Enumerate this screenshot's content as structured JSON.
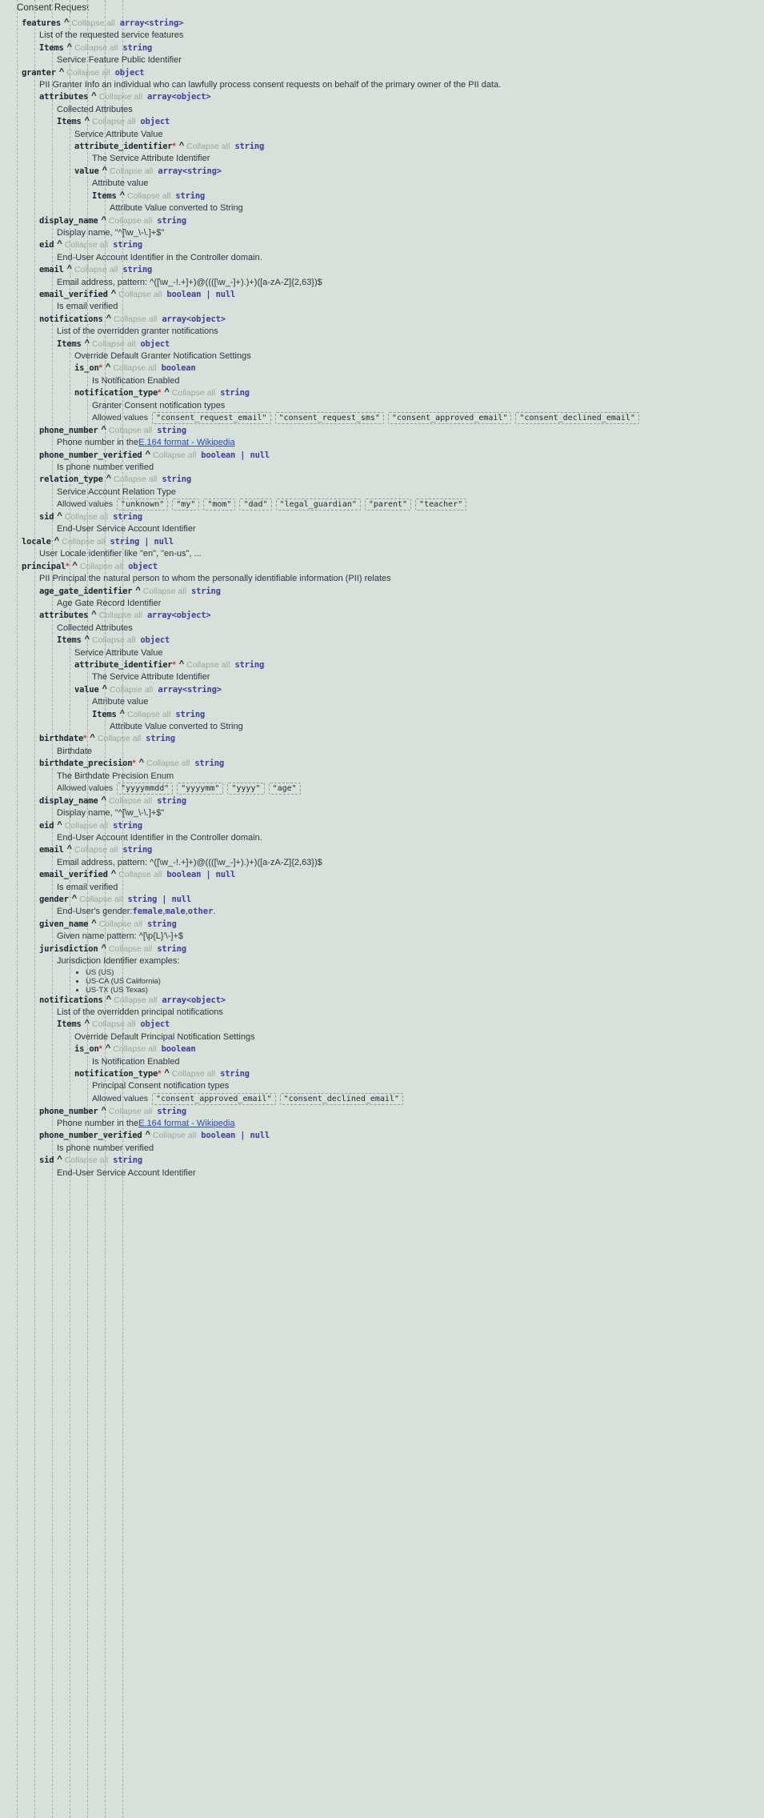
{
  "page": {
    "title": "Consent Request",
    "collapse_label": "Collapse all",
    "allowed_values_label": "Allowed values",
    "required_marker": "*",
    "caret_glyph": "^",
    "colors": {
      "background": "#d7e0d9",
      "type_text": "#3b3fa0",
      "required": "#e03131",
      "collapse": "#9aa6a0",
      "link": "#2848b8",
      "guide": "#9fb0a6"
    }
  },
  "rows": [
    {
      "depth": 0,
      "kind": "prop",
      "key": "features",
      "type": "array<string>"
    },
    {
      "depth": 1,
      "kind": "desc",
      "text": "List of the requested service features"
    },
    {
      "depth": 1,
      "kind": "prop",
      "key": "Items",
      "type": "string"
    },
    {
      "depth": 2,
      "kind": "desc",
      "text": "Service Feature Public Identifier"
    },
    {
      "depth": 0,
      "kind": "prop",
      "key": "granter",
      "type": "object"
    },
    {
      "depth": 1,
      "kind": "desc",
      "text": "PII Granter Info an individual who can lawfully process consent requests on behalf of the primary owner of the PII data."
    },
    {
      "depth": 1,
      "kind": "prop",
      "key": "attributes",
      "type": "array<object>"
    },
    {
      "depth": 2,
      "kind": "desc",
      "text": "Collected Attributes"
    },
    {
      "depth": 2,
      "kind": "prop",
      "key": "Items",
      "type": "object"
    },
    {
      "depth": 3,
      "kind": "desc",
      "text": "Service Attribute Value"
    },
    {
      "depth": 3,
      "kind": "prop",
      "key": "attribute_identifier",
      "required": true,
      "type": "string"
    },
    {
      "depth": 4,
      "kind": "desc",
      "text": "The Service Attribute Identifier"
    },
    {
      "depth": 3,
      "kind": "prop",
      "key": "value",
      "type": "array<string>"
    },
    {
      "depth": 4,
      "kind": "desc",
      "text": "Attribute value"
    },
    {
      "depth": 4,
      "kind": "prop",
      "key": "Items",
      "type": "string"
    },
    {
      "depth": 5,
      "kind": "desc",
      "text": "Attribute Value converted to String"
    },
    {
      "depth": 1,
      "kind": "prop",
      "key": "display_name",
      "type": "string"
    },
    {
      "depth": 2,
      "kind": "desc",
      "text": "Display name, \"^[\\w_\\-\\.]+$\""
    },
    {
      "depth": 1,
      "kind": "prop",
      "key": "eid",
      "type": "string"
    },
    {
      "depth": 2,
      "kind": "desc",
      "text": "End-User Account Identifier in the Controller domain."
    },
    {
      "depth": 1,
      "kind": "prop",
      "key": "email",
      "type": "string"
    },
    {
      "depth": 2,
      "kind": "desc",
      "text": "Email address, pattern: ^([\\w_-!.+]+)@((([\\w_-]+).)+)([a-zA-Z]{2,63})$"
    },
    {
      "depth": 1,
      "kind": "prop",
      "key": "email_verified",
      "type": "boolean | null"
    },
    {
      "depth": 2,
      "kind": "desc",
      "text": "Is email verified"
    },
    {
      "depth": 1,
      "kind": "prop",
      "key": "notifications",
      "type": "array<object>"
    },
    {
      "depth": 2,
      "kind": "desc",
      "text": "List of the overridden granter notifications"
    },
    {
      "depth": 2,
      "kind": "prop",
      "key": "Items",
      "type": "object"
    },
    {
      "depth": 3,
      "kind": "desc",
      "text": "Override Default Granter Notification Settings"
    },
    {
      "depth": 3,
      "kind": "prop",
      "key": "is_on",
      "required": true,
      "type": "boolean"
    },
    {
      "depth": 4,
      "kind": "desc",
      "text": "Is Notification Enabled"
    },
    {
      "depth": 3,
      "kind": "prop",
      "key": "notification_type",
      "required": true,
      "type": "string"
    },
    {
      "depth": 4,
      "kind": "desc",
      "text": "Granter Consent notification types"
    },
    {
      "depth": 4,
      "kind": "allowed",
      "values": [
        "\"consent_request_email\"",
        "\"consent_request_sms\"",
        "\"consent_approved_email\"",
        "\"consent_declined_email\""
      ]
    },
    {
      "depth": 1,
      "kind": "prop",
      "key": "phone_number",
      "type": "string"
    },
    {
      "depth": 2,
      "kind": "desc_link",
      "prefix": "Phone number in the ",
      "link": "E.164 format - Wikipedia",
      "suffix": ""
    },
    {
      "depth": 1,
      "kind": "prop",
      "key": "phone_number_verified",
      "type": "boolean | null"
    },
    {
      "depth": 2,
      "kind": "desc",
      "text": "Is phone number verified"
    },
    {
      "depth": 1,
      "kind": "prop",
      "key": "relation_type",
      "type": "string"
    },
    {
      "depth": 2,
      "kind": "desc",
      "text": "Service Account Relation Type"
    },
    {
      "depth": 2,
      "kind": "allowed",
      "values": [
        "\"unknown\"",
        "\"my\"",
        "\"mom\"",
        "\"dad\"",
        "\"legal_guardian\"",
        "\"parent\"",
        "\"teacher\""
      ]
    },
    {
      "depth": 1,
      "kind": "prop",
      "key": "sid",
      "type": "string"
    },
    {
      "depth": 2,
      "kind": "desc",
      "text": "End-User Service Account Identifier"
    },
    {
      "depth": 0,
      "kind": "prop",
      "key": "locale",
      "type": "string | null"
    },
    {
      "depth": 1,
      "kind": "desc",
      "text": "User Locale identifier like \"en\", \"en-us\", ..."
    },
    {
      "depth": 0,
      "kind": "prop",
      "key": "principal",
      "required": true,
      "type": "object"
    },
    {
      "depth": 1,
      "kind": "desc",
      "text": "PII Principal the natural person to whom the personally identifiable information (PII) relates"
    },
    {
      "depth": 1,
      "kind": "prop",
      "key": "age_gate_identifier",
      "type": "string"
    },
    {
      "depth": 2,
      "kind": "desc",
      "text": "Age Gate Record Identifier"
    },
    {
      "depth": 1,
      "kind": "prop",
      "key": "attributes",
      "type": "array<object>"
    },
    {
      "depth": 2,
      "kind": "desc",
      "text": "Collected Attributes"
    },
    {
      "depth": 2,
      "kind": "prop",
      "key": "Items",
      "type": "object"
    },
    {
      "depth": 3,
      "kind": "desc",
      "text": "Service Attribute Value"
    },
    {
      "depth": 3,
      "kind": "prop",
      "key": "attribute_identifier",
      "required": true,
      "type": "string"
    },
    {
      "depth": 4,
      "kind": "desc",
      "text": "The Service Attribute Identifier"
    },
    {
      "depth": 3,
      "kind": "prop",
      "key": "value",
      "type": "array<string>"
    },
    {
      "depth": 4,
      "kind": "desc",
      "text": "Attribute value"
    },
    {
      "depth": 4,
      "kind": "prop",
      "key": "Items",
      "type": "string"
    },
    {
      "depth": 5,
      "kind": "desc",
      "text": "Attribute Value converted to String"
    },
    {
      "depth": 1,
      "kind": "prop",
      "key": "birthdate",
      "required": true,
      "type": "string"
    },
    {
      "depth": 2,
      "kind": "desc",
      "text": "Birthdate"
    },
    {
      "depth": 1,
      "kind": "prop",
      "key": "birthdate_precision",
      "required": true,
      "type": "string"
    },
    {
      "depth": 2,
      "kind": "desc",
      "text": "The Birthdate Precision Enum"
    },
    {
      "depth": 2,
      "kind": "allowed",
      "values": [
        "\"yyyymmdd\"",
        "\"yyyymm\"",
        "\"yyyy\"",
        "\"age\""
      ]
    },
    {
      "depth": 1,
      "kind": "prop",
      "key": "display_name",
      "type": "string"
    },
    {
      "depth": 2,
      "kind": "desc",
      "text": "Display name, \"^[\\w_\\-\\.]+$\""
    },
    {
      "depth": 1,
      "kind": "prop",
      "key": "eid",
      "type": "string"
    },
    {
      "depth": 2,
      "kind": "desc",
      "text": "End-User Account Identifier in the Controller domain."
    },
    {
      "depth": 1,
      "kind": "prop",
      "key": "email",
      "type": "string"
    },
    {
      "depth": 2,
      "kind": "desc",
      "text": "Email address, pattern: ^([\\w_-!.+]+)@((([\\w_-]+).)+)([a-zA-Z]{2,63})$"
    },
    {
      "depth": 1,
      "kind": "prop",
      "key": "email_verified",
      "type": "boolean | null"
    },
    {
      "depth": 2,
      "kind": "desc",
      "text": "Is email verified"
    },
    {
      "depth": 1,
      "kind": "prop",
      "key": "gender",
      "type": "string | null"
    },
    {
      "depth": 2,
      "kind": "desc_enum",
      "prefix": "End-User's gender: ",
      "enums": [
        "female",
        "male",
        "other"
      ],
      "suffix": "."
    },
    {
      "depth": 1,
      "kind": "prop",
      "key": "given_name",
      "type": "string"
    },
    {
      "depth": 2,
      "kind": "desc",
      "text": "Given name pattern: ^[\\p{L}'\\-]+$"
    },
    {
      "depth": 1,
      "kind": "prop",
      "key": "jurisdiction",
      "type": "string"
    },
    {
      "depth": 2,
      "kind": "desc",
      "text": "Jurisdiction Identifier examples:"
    },
    {
      "depth": 2,
      "kind": "bullets",
      "items": [
        "US (US)",
        "US-CA (US California)",
        "US-TX (US Texas)"
      ]
    },
    {
      "depth": 1,
      "kind": "prop",
      "key": "notifications",
      "type": "array<object>"
    },
    {
      "depth": 2,
      "kind": "desc",
      "text": "List of the overridden principal notifications"
    },
    {
      "depth": 2,
      "kind": "prop",
      "key": "Items",
      "type": "object"
    },
    {
      "depth": 3,
      "kind": "desc",
      "text": "Override Default Principal Notification Settings"
    },
    {
      "depth": 3,
      "kind": "prop",
      "key": "is_on",
      "required": true,
      "type": "boolean"
    },
    {
      "depth": 4,
      "kind": "desc",
      "text": "Is Notification Enabled"
    },
    {
      "depth": 3,
      "kind": "prop",
      "key": "notification_type",
      "required": true,
      "type": "string"
    },
    {
      "depth": 4,
      "kind": "desc",
      "text": "Principal Consent notification types"
    },
    {
      "depth": 4,
      "kind": "allowed",
      "values": [
        "\"consent_approved_email\"",
        "\"consent_declined_email\""
      ]
    },
    {
      "depth": 1,
      "kind": "prop",
      "key": "phone_number",
      "type": "string"
    },
    {
      "depth": 2,
      "kind": "desc_link",
      "prefix": "Phone number in the ",
      "link": "E.164 format - Wikipedia",
      "suffix": ""
    },
    {
      "depth": 1,
      "kind": "prop",
      "key": "phone_number_verified",
      "type": "boolean | null"
    },
    {
      "depth": 2,
      "kind": "desc",
      "text": "Is phone number verified"
    },
    {
      "depth": 1,
      "kind": "prop",
      "key": "sid",
      "type": "string"
    },
    {
      "depth": 2,
      "kind": "desc",
      "text": "End-User Service Account Identifier"
    }
  ]
}
